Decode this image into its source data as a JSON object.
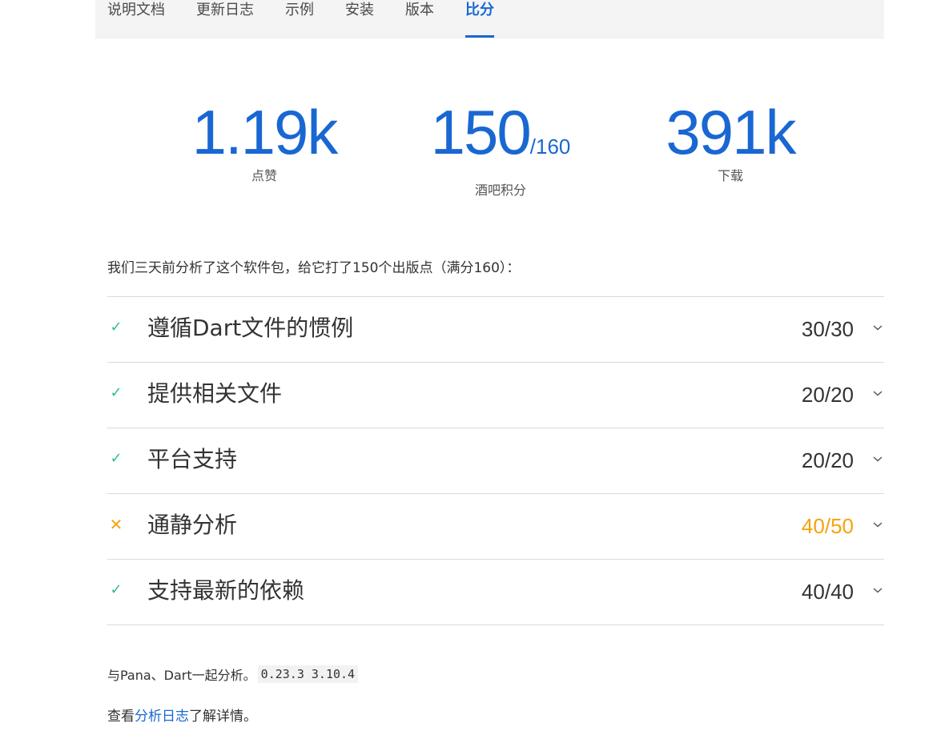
{
  "tabs": [
    {
      "label": "说明文档",
      "active": false
    },
    {
      "label": "更新日志",
      "active": false
    },
    {
      "label": "示例",
      "active": false
    },
    {
      "label": "安装",
      "active": false
    },
    {
      "label": "版本",
      "active": false
    },
    {
      "label": "比分",
      "active": true
    }
  ],
  "stats": {
    "likes": {
      "value": "1.19k",
      "label": "点赞"
    },
    "points": {
      "value": "150",
      "max": "/160",
      "label": "酒吧积分"
    },
    "downloads": {
      "value": "391k",
      "label": "下载"
    }
  },
  "summary": "我们三天前分析了这个软件包，给它打了150个出版点（满分160）：",
  "sections": [
    {
      "title": "遵循Dart文件的惯例",
      "score": "30/30",
      "status": "pass",
      "status_icon": "check-icon"
    },
    {
      "title": "提供相关文件",
      "score": "20/20",
      "status": "pass",
      "status_icon": "check-icon"
    },
    {
      "title": "平台支持",
      "score": "20/20",
      "status": "pass",
      "status_icon": "check-icon"
    },
    {
      "title": "通静分析",
      "score": "40/50",
      "status": "partial",
      "status_icon": "cross-icon"
    },
    {
      "title": "支持最新的依赖",
      "score": "40/40",
      "status": "pass",
      "status_icon": "check-icon"
    }
  ],
  "analysis": {
    "prefix": "与Pana、Dart一起分析。",
    "pana_version": "0.23.3",
    "dart_version": "3.10.4"
  },
  "details": {
    "prefix": "查看",
    "link_label": "分析日志",
    "suffix": "了解详情。"
  },
  "colors": {
    "accent": "#1967d2",
    "pass": "#2dbd8e",
    "partial": "#f5a30d",
    "text": "#333333"
  }
}
